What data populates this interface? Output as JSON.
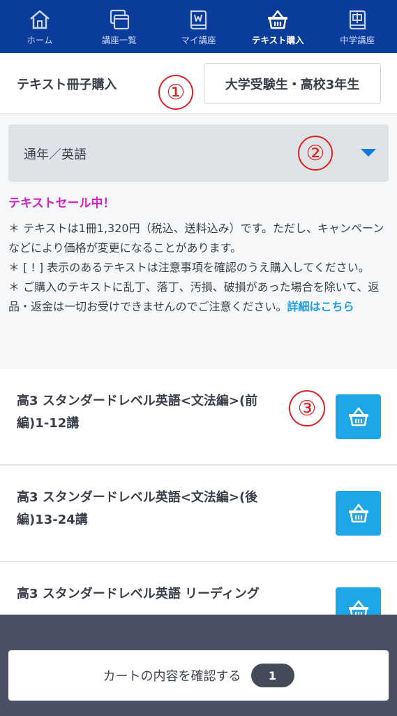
{
  "nav": {
    "items": [
      {
        "label": "ホーム",
        "icon": "home-icon"
      },
      {
        "label": "講座一覧",
        "icon": "course-list-icon"
      },
      {
        "label": "マイ講座",
        "icon": "my-course-icon"
      },
      {
        "label": "テキスト購入",
        "icon": "basket-icon",
        "active": true
      },
      {
        "label": "中学講座",
        "icon": "junior-high-icon"
      }
    ]
  },
  "header": {
    "title": "テキスト冊子購入",
    "grade_button": "大学受験生・高校3年生"
  },
  "annotations": {
    "one": "①",
    "two": "②",
    "three": "③"
  },
  "filter": {
    "selected": "通年／英語"
  },
  "info": {
    "sale_title": "テキストセール中！",
    "note1": "＊ テキストは1冊1,320円（税込、送料込み）です。ただし、キャンペーンなどにより価格が変更になることがあります。",
    "note2": "＊ [ ! ] 表示のあるテキストは注意事項を確認のうえ購入してください。",
    "note3": "＊ ご購入のテキストに乱丁、落丁、汚損、破損があった場合を除いて、返品・返金は一切お受けできませんのでご注意ください。",
    "details_link": "詳細はこちら"
  },
  "products": [
    {
      "title": "高3 スタンダードレベル英語<文法編>(前編)1-12講"
    },
    {
      "title": "高3 スタンダードレベル英語<文法編>(後編)13-24講"
    },
    {
      "title": "高3 スタンダードレベル英語 リーディング"
    }
  ],
  "cart": {
    "confirm_label": "カートの内容を確認する",
    "count": "1"
  },
  "colors": {
    "nav_bg": "#0a3c9c",
    "accent_blue": "#1ea7e8",
    "sale_magenta": "#d21fc5",
    "annotation_red": "#e02121",
    "bottom_bar": "#4a4f62"
  }
}
